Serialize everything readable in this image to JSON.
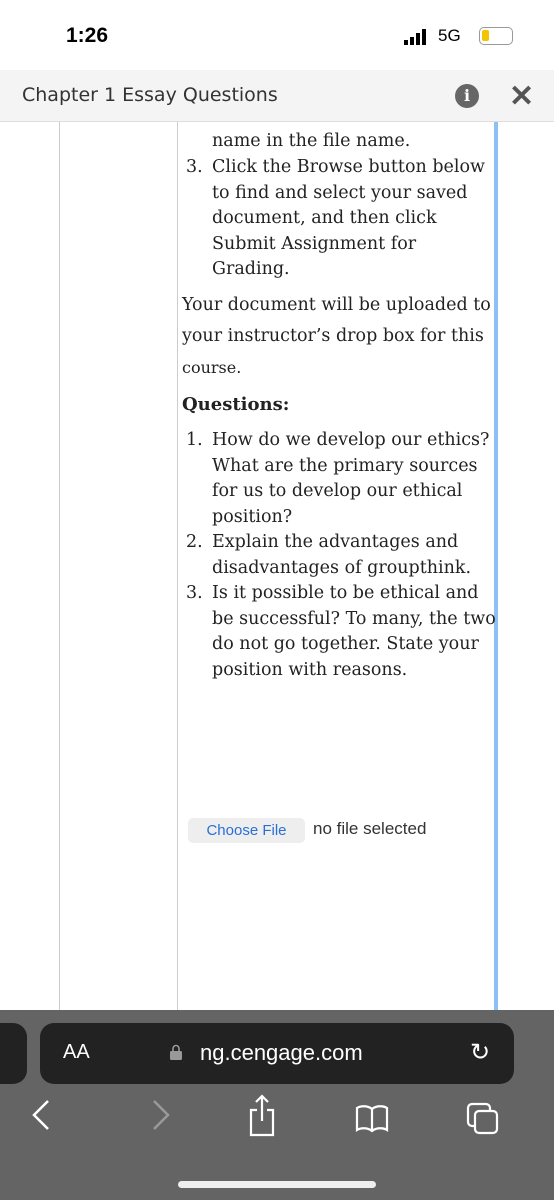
{
  "status": {
    "time": "1:26",
    "network": "5G",
    "battery_level": 0.25
  },
  "header": {
    "title": "Chapter 1 Essay Questions",
    "info_icon": "info-icon",
    "close_icon": "close-icon"
  },
  "content": {
    "step2_tail": "name in the file name.",
    "step3": {
      "num": "3.",
      "lines": [
        "Click the Browse button below",
        "to find and select your saved",
        "document, and then click",
        "Submit Assignment for",
        "Grading."
      ]
    },
    "upload_para": [
      "Your document will be uploaded to",
      "your instructor’s drop box for this",
      "course."
    ],
    "questions_heading": "Questions:",
    "questions": [
      {
        "num": "1.",
        "lines": [
          "How do we develop our ethics?",
          "What are the primary sources",
          "for us to develop our ethical",
          "position?"
        ]
      },
      {
        "num": "2.",
        "lines": [
          "Explain the advantages and",
          "disadvantages of groupthink."
        ]
      },
      {
        "num": "3.",
        "lines": [
          "Is it possible to be ethical and",
          "be successful? To many, the two",
          "do not go together. State your",
          "position with reasons."
        ]
      }
    ],
    "choose_file": "Choose File",
    "no_file": "no file selected"
  },
  "browser": {
    "text_size": "AA",
    "url": "ng.cengage.com",
    "accent": "#8ec0f5"
  }
}
